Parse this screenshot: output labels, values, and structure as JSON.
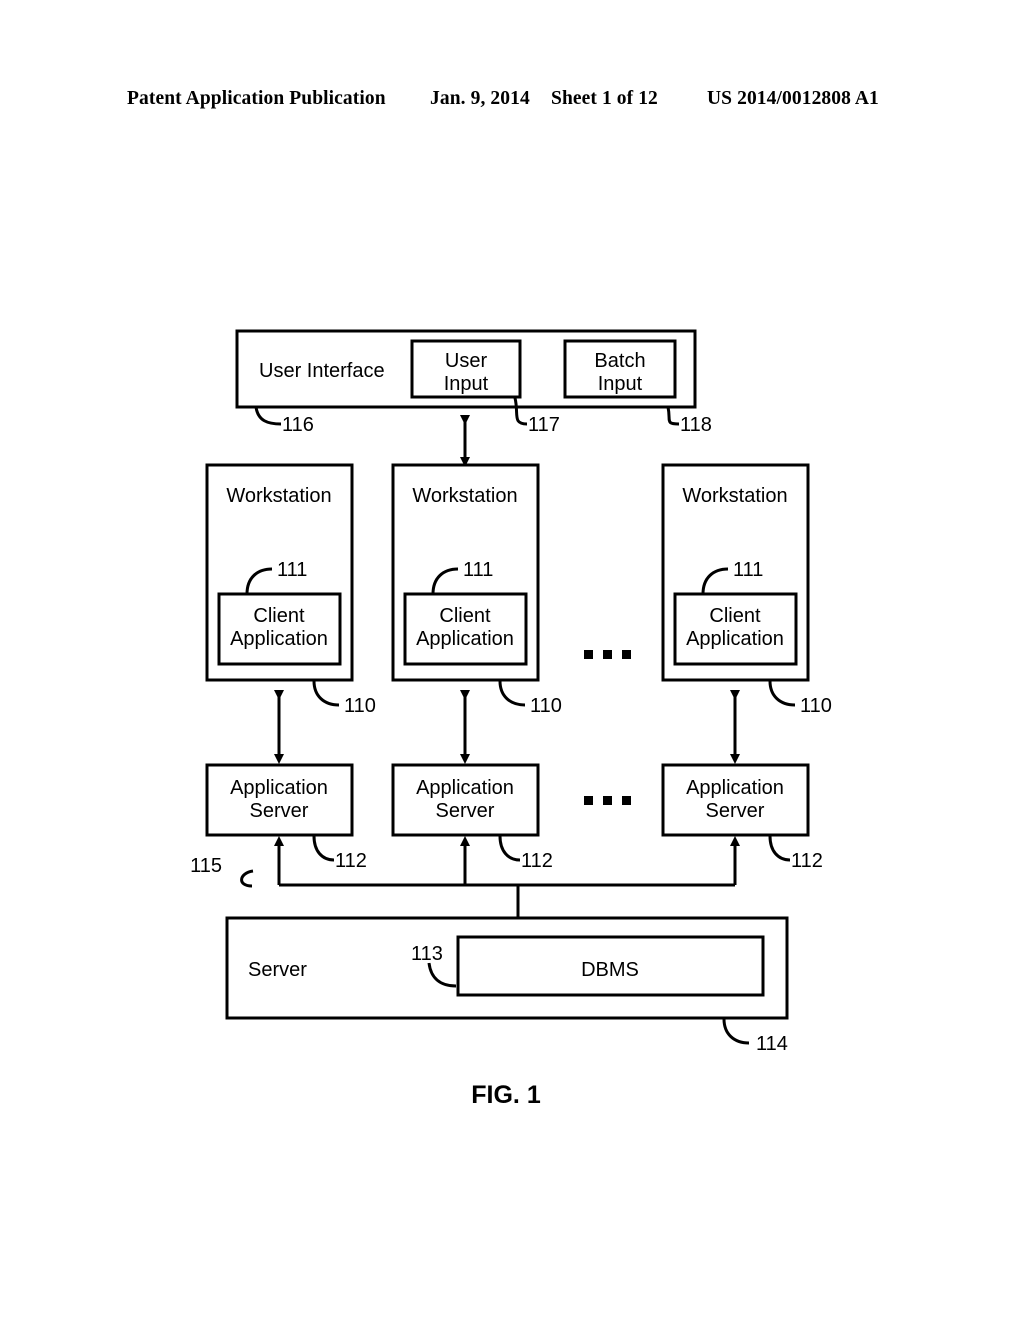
{
  "header": {
    "left": "Patent Application Publication",
    "date": "Jan. 9, 2014",
    "sheet": "Sheet 1 of 12",
    "pub_number": "US 2014/0012808 A1"
  },
  "figure": {
    "caption": "FIG. 1",
    "ui_band": {
      "label": "User Interface",
      "ref": "116",
      "user_input": {
        "line1": "User",
        "line2": "Input",
        "ref": "117"
      },
      "batch_input": {
        "line1": "Batch",
        "line2": "Input",
        "ref": "118"
      }
    },
    "workstations": [
      {
        "title": "Workstation",
        "ref": "110",
        "client": {
          "line1": "Client",
          "line2": "Application",
          "ref": "111"
        }
      },
      {
        "title": "Workstation",
        "ref": "110",
        "client": {
          "line1": "Client",
          "line2": "Application",
          "ref": "111"
        }
      },
      {
        "title": "Workstation",
        "ref": "110",
        "client": {
          "line1": "Client",
          "line2": "Application",
          "ref": "111"
        }
      }
    ],
    "app_servers": [
      {
        "line1": "Application",
        "line2": "Server",
        "ref": "112"
      },
      {
        "line1": "Application",
        "line2": "Server",
        "ref": "112"
      },
      {
        "line1": "Application",
        "line2": "Server",
        "ref": "112"
      }
    ],
    "bus": {
      "ref": "115"
    },
    "server": {
      "label": "Server",
      "ref": "114",
      "dbms": {
        "label": "DBMS",
        "ref": "113"
      }
    },
    "ellipsis": "▪ ▪ ▪"
  },
  "colors": {
    "ink": "#000000",
    "paper": "#ffffff"
  }
}
